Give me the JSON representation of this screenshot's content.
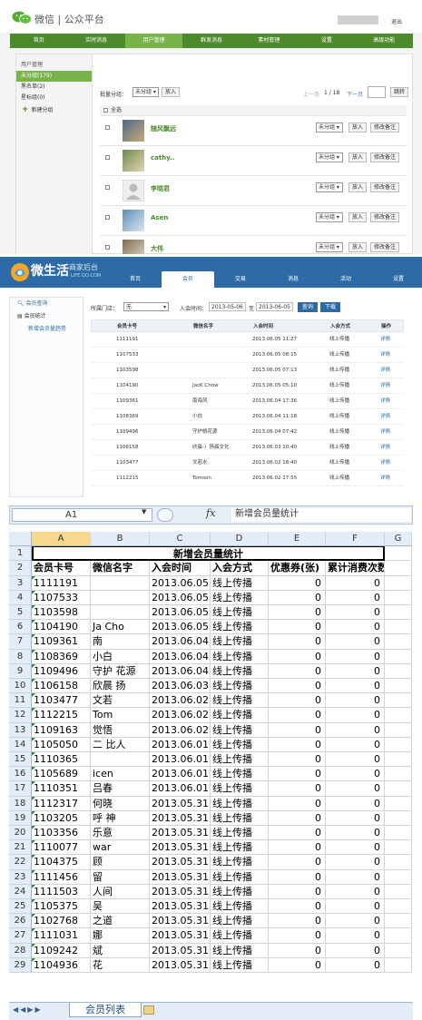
{
  "wechat": {
    "title": "微信 | 公众平台",
    "logout": "退出",
    "nav": [
      "首页",
      "实时消息",
      "用户管理",
      "群发消息",
      "素材管理",
      "设置",
      "高级功能"
    ],
    "active_tab": 2,
    "sidebar": {
      "heading": "用户管理",
      "groups": [
        "未分组(179)",
        "黑名单(2)",
        "星标组(0)"
      ],
      "new_group": "新建分组"
    },
    "toolbar": {
      "batch_label": "批量分组：",
      "select": "未分组",
      "put_button": "放入",
      "prev": "上一页",
      "page": "1 / 18",
      "next": "下一页",
      "jump": "跳转"
    },
    "select_all": "全选",
    "users": [
      {
        "name": "随风飘远",
        "group": "未分组",
        "put": "放入",
        "remark": "修改备注"
      },
      {
        "name": "cathy..",
        "group": "未分组",
        "put": "放入",
        "remark": "修改备注"
      },
      {
        "name": "李晓君",
        "group": "未分组",
        "put": "放入",
        "remark": "修改备注"
      },
      {
        "name": "Asen",
        "group": "未分组",
        "put": "放入",
        "remark": "修改备注"
      },
      {
        "name": "大伟",
        "group": "未分组",
        "put": "放入",
        "remark": "修改备注"
      }
    ]
  },
  "weishenghuo": {
    "brand": "微生活",
    "sub": "商家后台",
    "url": "LIFE.QQ.COM",
    "nav": [
      "首页",
      "会员",
      "交易",
      "消息",
      "活动",
      "设置"
    ],
    "active_tab": 1,
    "sidebar": {
      "query": "会员查询",
      "stats": "会员统计",
      "trend": "新增会员量趋势"
    },
    "filter": {
      "store_label": "所属门店：",
      "store_value": "无",
      "time_label": "入会时间：",
      "from": "2013-05-06",
      "to_label": "至",
      "to": "2013-06-05",
      "query_button": "查询",
      "download_button": "下载"
    },
    "headers": [
      "会员卡号",
      "微信名字",
      "入会时间",
      "入会方式",
      "操作"
    ],
    "rows": [
      [
        "1111191",
        "",
        "2013.06.05 11:27",
        "线上传播",
        "详情"
      ],
      [
        "1107533",
        "",
        "2013.06.05 08:15",
        "线上传播",
        "详情"
      ],
      [
        "1103598",
        "",
        "2013.06.05 07:13",
        "线上传播",
        "详情"
      ],
      [
        "1104190",
        "JacK Chow",
        "2013.06.05 05:10",
        "线上传播",
        "详情"
      ],
      [
        "1109361",
        "南海风",
        "2013.06.04 17:36",
        "线上传播",
        "详情"
      ],
      [
        "1108369",
        "小白",
        "2013.06.04 11:18",
        "线上传播",
        "详情"
      ],
      [
        "1109496",
        "守护桃花源",
        "2013.06.04 07:42",
        "线上传播",
        "详情"
      ],
      [
        "1106158",
        "欣晨-）扬晨文化",
        "2013.06.03 10:40",
        "线上传播",
        "详情"
      ],
      [
        "1103477",
        "文若水",
        "2013.06.02 18:40",
        "线上传播",
        "详情"
      ],
      [
        "1112215",
        "Tomson",
        "2013.06.02 17:55",
        "线上传播",
        "详情"
      ]
    ]
  },
  "excel": {
    "name_box": "A1",
    "fx": "fx",
    "formula": "新增会员量统计",
    "columns": [
      "A",
      "B",
      "C",
      "D",
      "E",
      "F",
      "G"
    ],
    "title": "新增会员量统计",
    "headers": [
      "会员卡号",
      "微信名字",
      "入会时间",
      "入会方式",
      "优惠券(张)",
      "累计消费次数"
    ],
    "rows": [
      [
        "1111191",
        "",
        "2013.06.05",
        "线上传播",
        "0",
        "0"
      ],
      [
        "1107533",
        "",
        "2013.06.05",
        "线上传播",
        "0",
        "0"
      ],
      [
        "1103598",
        "",
        "2013.06.05",
        "线上传播",
        "0",
        "0"
      ],
      [
        "1104190",
        "Ja Cho",
        "2013.06.05",
        "线上传播",
        "0",
        "0"
      ],
      [
        "1109361",
        "南",
        "2013.06.04",
        "线上传播",
        "0",
        "0"
      ],
      [
        "1108369",
        "小白",
        "2013.06.04",
        "线上传播",
        "0",
        "0"
      ],
      [
        "1109496",
        "守护 花源",
        "2013.06.04",
        "线上传播",
        "0",
        "0"
      ],
      [
        "1106158",
        "欣晨 扬",
        "2013.06.03",
        "线上传播",
        "0",
        "0"
      ],
      [
        "1103477",
        "文若",
        "2013.06.02",
        "线上传播",
        "0",
        "0"
      ],
      [
        "1112215",
        "Tom",
        "2013.06.02",
        "线上传播",
        "0",
        "0"
      ],
      [
        "1109163",
        "觉悟",
        "2013.06.02",
        "线上传播",
        "0",
        "0"
      ],
      [
        "1105050",
        "二 比人",
        "2013.06.01",
        "线上传播",
        "0",
        "0"
      ],
      [
        "1110365",
        "",
        "2013.06.01",
        "线上传播",
        "0",
        "0"
      ],
      [
        "1105689",
        "icen",
        "2013.06.01",
        "线上传播",
        "0",
        "0"
      ],
      [
        "1110351",
        "吕春",
        "2013.06.01",
        "线上传播",
        "0",
        "0"
      ],
      [
        "1112317",
        "何晓",
        "2013.05.31",
        "线上传播",
        "0",
        "0"
      ],
      [
        "1103205",
        "呼 神",
        "2013.05.31",
        "线上传播",
        "0",
        "0"
      ],
      [
        "1103356",
        "乐意",
        "2013.05.31",
        "线上传播",
        "0",
        "0"
      ],
      [
        "1110077",
        "war",
        "2013.05.31",
        "线上传播",
        "0",
        "0"
      ],
      [
        "1104375",
        "顾",
        "2013.05.31",
        "线上传播",
        "0",
        "0"
      ],
      [
        "1111456",
        "留",
        "2013.05.31",
        "线上传播",
        "0",
        "0"
      ],
      [
        "1111503",
        "人间",
        "2013.05.31",
        "线上传播",
        "0",
        "0"
      ],
      [
        "1105375",
        "吴",
        "2013.05.31",
        "线上传播",
        "0",
        "0"
      ],
      [
        "1102768",
        "之道",
        "2013.05.31",
        "线上传播",
        "0",
        "0"
      ],
      [
        "1111031",
        "娜",
        "2013.05.31",
        "线上传播",
        "0",
        "0"
      ],
      [
        "1109242",
        "斌",
        "2013.05.31",
        "线上传播",
        "0",
        "0"
      ],
      [
        "1104936",
        "花",
        "2013.05.31",
        "线上传播",
        "0",
        "0"
      ]
    ],
    "sheet_tab": "会员列表"
  }
}
